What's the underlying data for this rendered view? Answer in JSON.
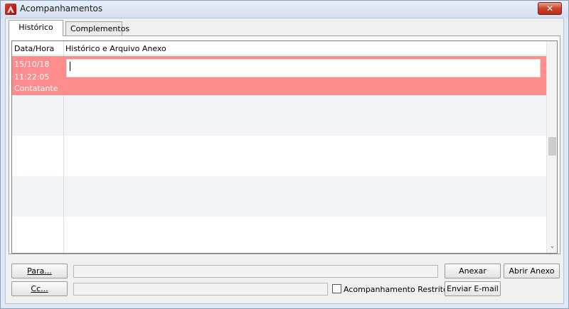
{
  "window": {
    "title": "Acompanhamentos",
    "close_symbol": "✕"
  },
  "tabs": [
    {
      "label": "Histórico",
      "active": true
    },
    {
      "label": "Complementos",
      "active": false
    }
  ],
  "grid": {
    "columns": [
      "Data/Hora",
      "Histórico e Arquivo Anexo"
    ],
    "selected_row": {
      "date": "15/10/18",
      "time": "11:22:05",
      "user": "Contatante",
      "history_text": ""
    },
    "selected_color": "#ff8c8c",
    "scroll_down_symbol": "⌄"
  },
  "actions": {
    "para_label": "Para...",
    "cc_label": "Cc...",
    "para_value": "",
    "cc_value": "",
    "restricted_label": "Acompanhamento Restrito",
    "restricted_checked": false,
    "anexar_label": "Anexar",
    "abrir_anexo_label": "Abrir Anexo",
    "enviar_email_label": "Enviar E-mail"
  }
}
